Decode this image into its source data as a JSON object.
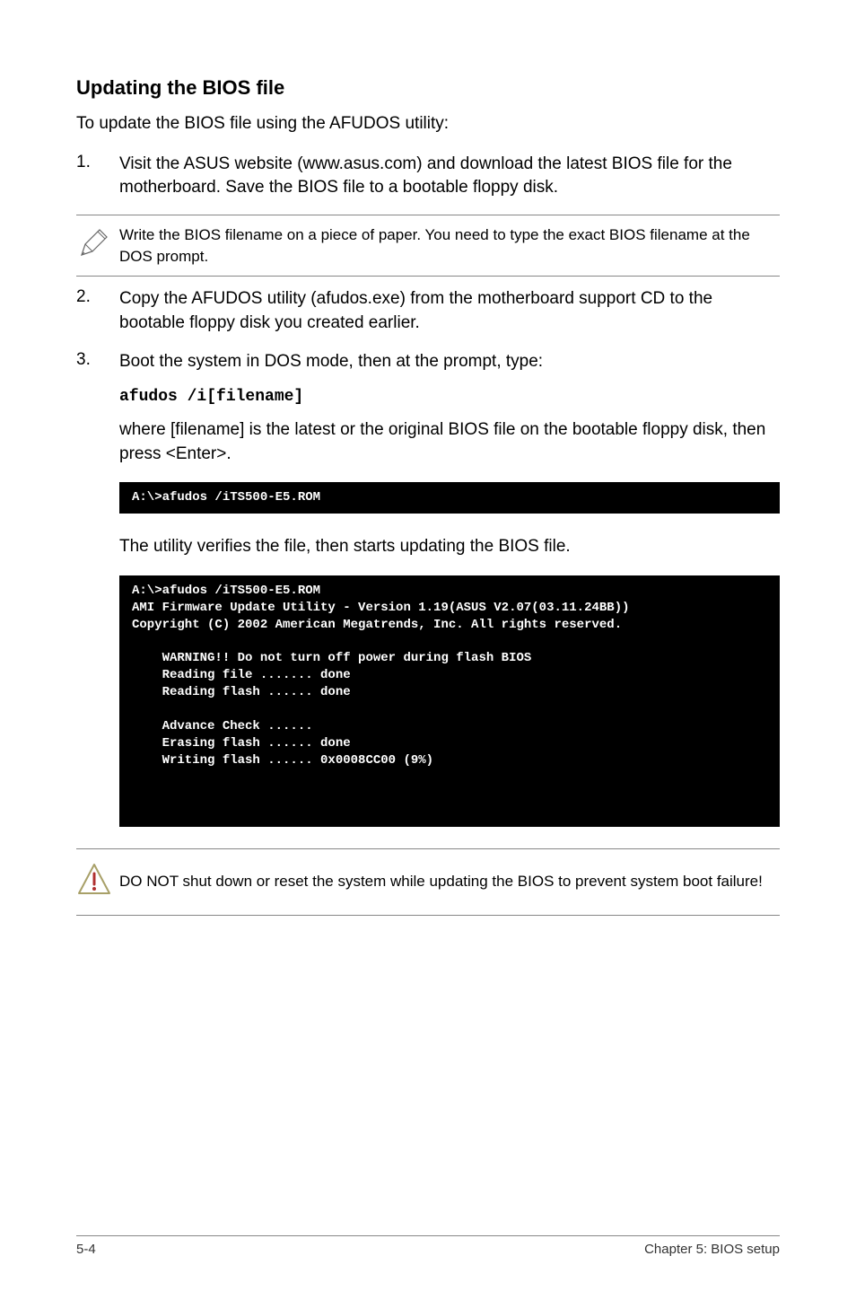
{
  "heading": "Updating the BIOS file",
  "intro": "To update the BIOS file using the AFUDOS utility:",
  "step1": {
    "num": "1.",
    "text": "Visit the ASUS website (www.asus.com) and download the latest BIOS file for the motherboard. Save the BIOS file to a bootable floppy disk."
  },
  "note1": "Write the BIOS filename on a piece of paper. You need to type the exact BIOS filename at the DOS prompt.",
  "step2": {
    "num": "2.",
    "text": "Copy the AFUDOS utility (afudos.exe) from the motherboard support CD to the bootable floppy disk you created earlier."
  },
  "step3": {
    "num": "3.",
    "text": "Boot the system in DOS mode, then at the prompt, type:"
  },
  "code_command": "afudos /i[filename]",
  "step3_cont": "where [filename] is the latest or the original BIOS file on the bootable floppy disk, then press <Enter>.",
  "terminal1": "A:\\>afudos /iTS500-E5.ROM",
  "verify_text": "The utility verifies the file, then starts updating the BIOS file.",
  "terminal2": "A:\\>afudos /iTS500-E5.ROM\nAMI Firmware Update Utility - Version 1.19(ASUS V2.07(03.11.24BB))\nCopyright (C) 2002 American Megatrends, Inc. All rights reserved.\n\n    WARNING!! Do not turn off power during flash BIOS\n    Reading file ....... done\n    Reading flash ...... done\n\n    Advance Check ......\n    Erasing flash ...... done\n    Writing flash ...... 0x0008CC00 (9%)",
  "warning": "DO NOT shut down or reset the system while updating the BIOS to prevent system boot failure!",
  "footer_left": "5-4",
  "footer_right": "Chapter 5: BIOS setup"
}
